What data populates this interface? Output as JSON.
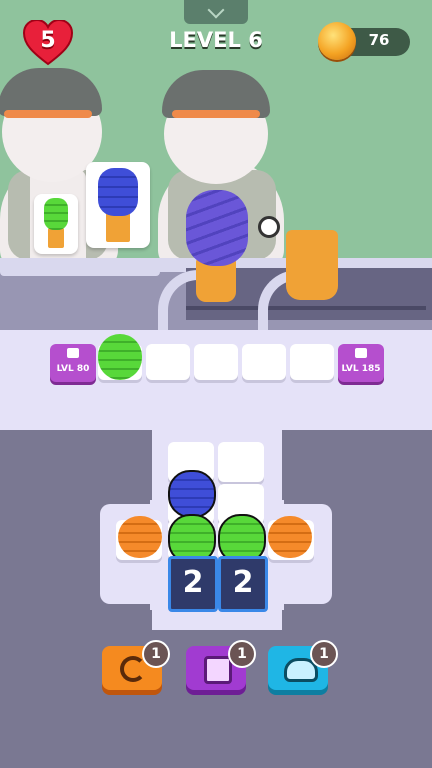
{
  "hud": {
    "lives": "5",
    "level": "LEVEL 6",
    "coins": "76",
    "icons": [
      "heart-icon",
      "coin-icon",
      "chevron-down-icon"
    ]
  },
  "queue": {
    "locks": [
      {
        "label": "LVL 80"
      },
      {
        "label": "LVL 185"
      }
    ],
    "slots": [
      "green-scoop",
      "empty",
      "empty",
      "empty",
      "empty"
    ]
  },
  "board": {
    "counters": [
      "2",
      "2"
    ],
    "scoops": [
      "blue",
      "orange",
      "green",
      "green",
      "orange"
    ]
  },
  "boosters": [
    {
      "name": "undo",
      "count": "1",
      "color": "#f58a1f"
    },
    {
      "name": "shuffle",
      "count": "1",
      "color": "#a13bd1"
    },
    {
      "name": "hint",
      "count": "1",
      "color": "#1fb6e5"
    }
  ],
  "colors": {
    "green": "#58d83a",
    "blue": "#3f4ed8",
    "orange": "#f58a2a",
    "purple": "#6a57d8",
    "cone": "#f0a236"
  }
}
